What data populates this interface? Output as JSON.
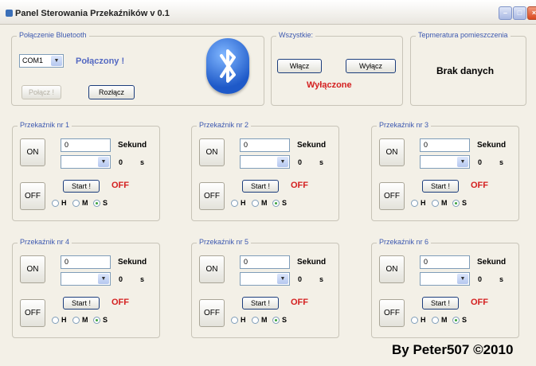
{
  "window": {
    "title": "Panel Sterowania Przekaźników v 0.1"
  },
  "bluetooth": {
    "group_label": "Połączenie Bluetooth",
    "port_value": "COM1",
    "status": "Połączony !",
    "connect_label": "Połącz !",
    "disconnect_label": "Rozłącz"
  },
  "all": {
    "group_label": "Wszystkie:",
    "on_label": "Włącz",
    "off_label": "Wyłącz",
    "status": "Wyłączone"
  },
  "temperature": {
    "group_label": "Tepmeratura pomieszczenia",
    "value": "Brak danych"
  },
  "relays": [
    {
      "label": "Przekaźnik nr 1",
      "on": "ON",
      "off": "OFF",
      "value": "0",
      "seconds": "Sekund",
      "count": "0",
      "unit": "s",
      "start": "Start !",
      "status": "OFF",
      "h": "H",
      "m": "M",
      "s": "S"
    },
    {
      "label": "Przekaźnik nr 2",
      "on": "ON",
      "off": "OFF",
      "value": "0",
      "seconds": "Sekund",
      "count": "0",
      "unit": "s",
      "start": "Start !",
      "status": "OFF",
      "h": "H",
      "m": "M",
      "s": "S"
    },
    {
      "label": "Przekaźnik nr 3",
      "on": "ON",
      "off": "OFF",
      "value": "0",
      "seconds": "Sekund",
      "count": "0",
      "unit": "s",
      "start": "Start !",
      "status": "OFF",
      "h": "H",
      "m": "M",
      "s": "S"
    },
    {
      "label": "Przekaźnik nr 4",
      "on": "ON",
      "off": "OFF",
      "value": "0",
      "seconds": "Sekund",
      "count": "0",
      "unit": "s",
      "start": "Start !",
      "status": "OFF",
      "h": "H",
      "m": "M",
      "s": "S"
    },
    {
      "label": "Przekaźnik nr 5",
      "on": "ON",
      "off": "OFF",
      "value": "0",
      "seconds": "Sekund",
      "count": "0",
      "unit": "s",
      "start": "Start !",
      "status": "OFF",
      "h": "H",
      "m": "M",
      "s": "S"
    },
    {
      "label": "Przekaźnik nr 6",
      "on": "ON",
      "off": "OFF",
      "value": "0",
      "seconds": "Sekund",
      "count": "0",
      "unit": "s",
      "start": "Start !",
      "status": "OFF",
      "h": "H",
      "m": "M",
      "s": "S"
    }
  ],
  "credit": "By Peter507 ©2010",
  "icons": {
    "app": "app-icon",
    "bluetooth": "bluetooth-icon",
    "minimize": "minimize-icon",
    "maximize": "maximize-icon",
    "close": "close-icon"
  },
  "colors": {
    "status_red": "#d42020",
    "status_blue": "#5469c2",
    "legend_blue": "#3d59b0"
  }
}
